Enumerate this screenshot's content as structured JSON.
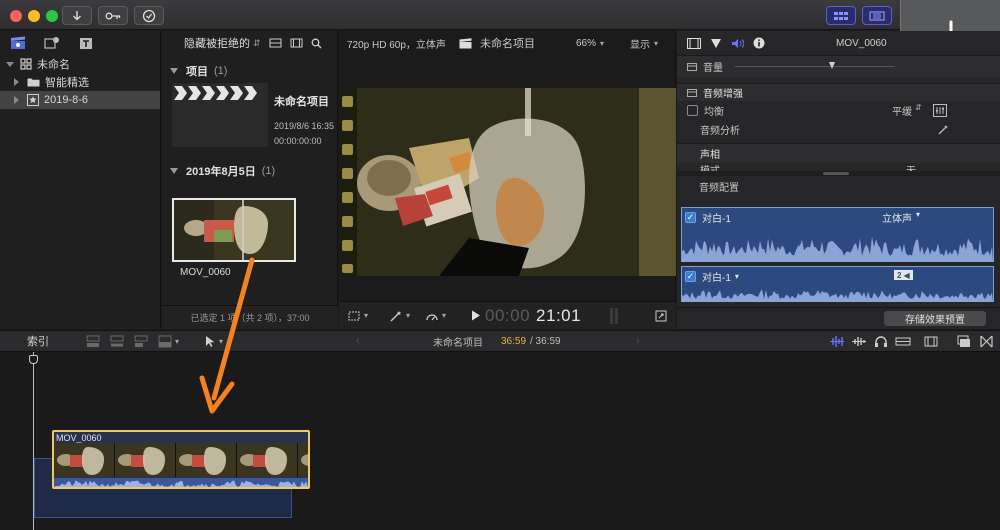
{
  "toolbar": {
    "import_icon": "download-arrow-icon",
    "keywords_icon": "key-icon",
    "background_tasks_icon": "check-circle-icon"
  },
  "library": {
    "items": [
      {
        "label": "未命名",
        "level": 0
      },
      {
        "label": "智能精选",
        "level": 1
      },
      {
        "label": "2019-8-6",
        "level": 1,
        "selected": true
      }
    ]
  },
  "browser": {
    "filter_label": "隐藏被拒绝的",
    "projects_section": {
      "title": "项目",
      "count": "(1)"
    },
    "project": {
      "name": "未命名项目",
      "date": "2019/8/6 16:35",
      "duration": "00:00:00:00"
    },
    "event_section": {
      "title": "2019年8月5日",
      "count": "(1)"
    },
    "clip": {
      "name": "MOV_0060"
    },
    "status": "已选定 1 项（共 2 项），37:00"
  },
  "viewer": {
    "format": "720p HD 60p，立体声",
    "project_name": "未命名项目",
    "zoom": "66%",
    "display_label": "显示",
    "timecode_dim": "00:00",
    "timecode_bright": "21:01"
  },
  "inspector": {
    "clip_name": "MOV_0060",
    "volume_label": "音量",
    "audio_enhance_title": "音频增强",
    "eq_label": "均衡",
    "eq_value": "平缓",
    "audio_analysis_label": "音频分析",
    "pan_title": "声相",
    "mode_label": "模式",
    "mode_value": "无",
    "audio_config_label": "音频配置",
    "channel1_name": "对白-1",
    "channel1_mode": "立体声",
    "channel2_name": "对白-1",
    "channel2_badge": "2",
    "save_preset_label": "存储效果预置"
  },
  "timeline": {
    "index_label": "索引",
    "project_name": "未命名项目",
    "time_current": "36:59",
    "time_total": "/ 36:59",
    "clip_name": "MOV_0060"
  },
  "colors": {
    "accent_blue": "#5b5fd6",
    "clip_border": "#f3c85a",
    "arrow": "#f5821f",
    "audio_blue": "#2c4a80"
  }
}
